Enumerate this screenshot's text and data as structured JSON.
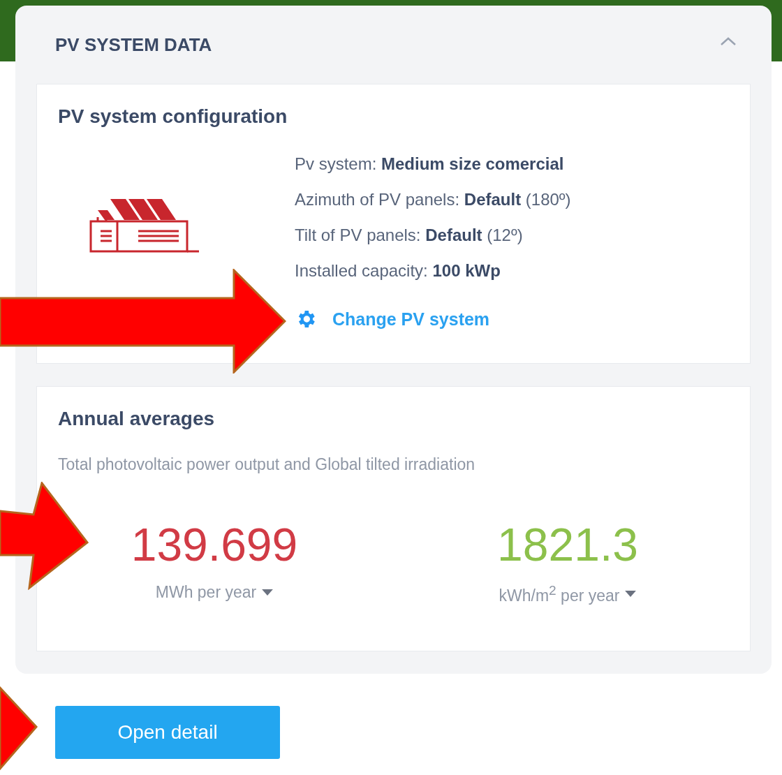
{
  "panel": {
    "title": "PV SYSTEM DATA",
    "expanded": true
  },
  "configuration": {
    "title": "PV system configuration",
    "details": [
      "Pv system: **Medium size comercial**",
      "Azimuth of PV panels: **Default** (180º)",
      "Tilt of PV panels: **Default** (12º)",
      "Installed capacity: **100 kWp**"
    ],
    "link": "Change PV system"
  },
  "averages": {
    "title": "Annual averages",
    "subtitle": "Total photovoltaic power output and Global tilted irradiation",
    "stats": [
      {
        "value": "139.699",
        "unit": "MWh per year",
        "color": "#d13b45"
      },
      {
        "value": "1821.3",
        "unit": "kWh/m$^{2}$ per year",
        "color": "#8cc04b"
      }
    ]
  },
  "button": "Open detail"
}
